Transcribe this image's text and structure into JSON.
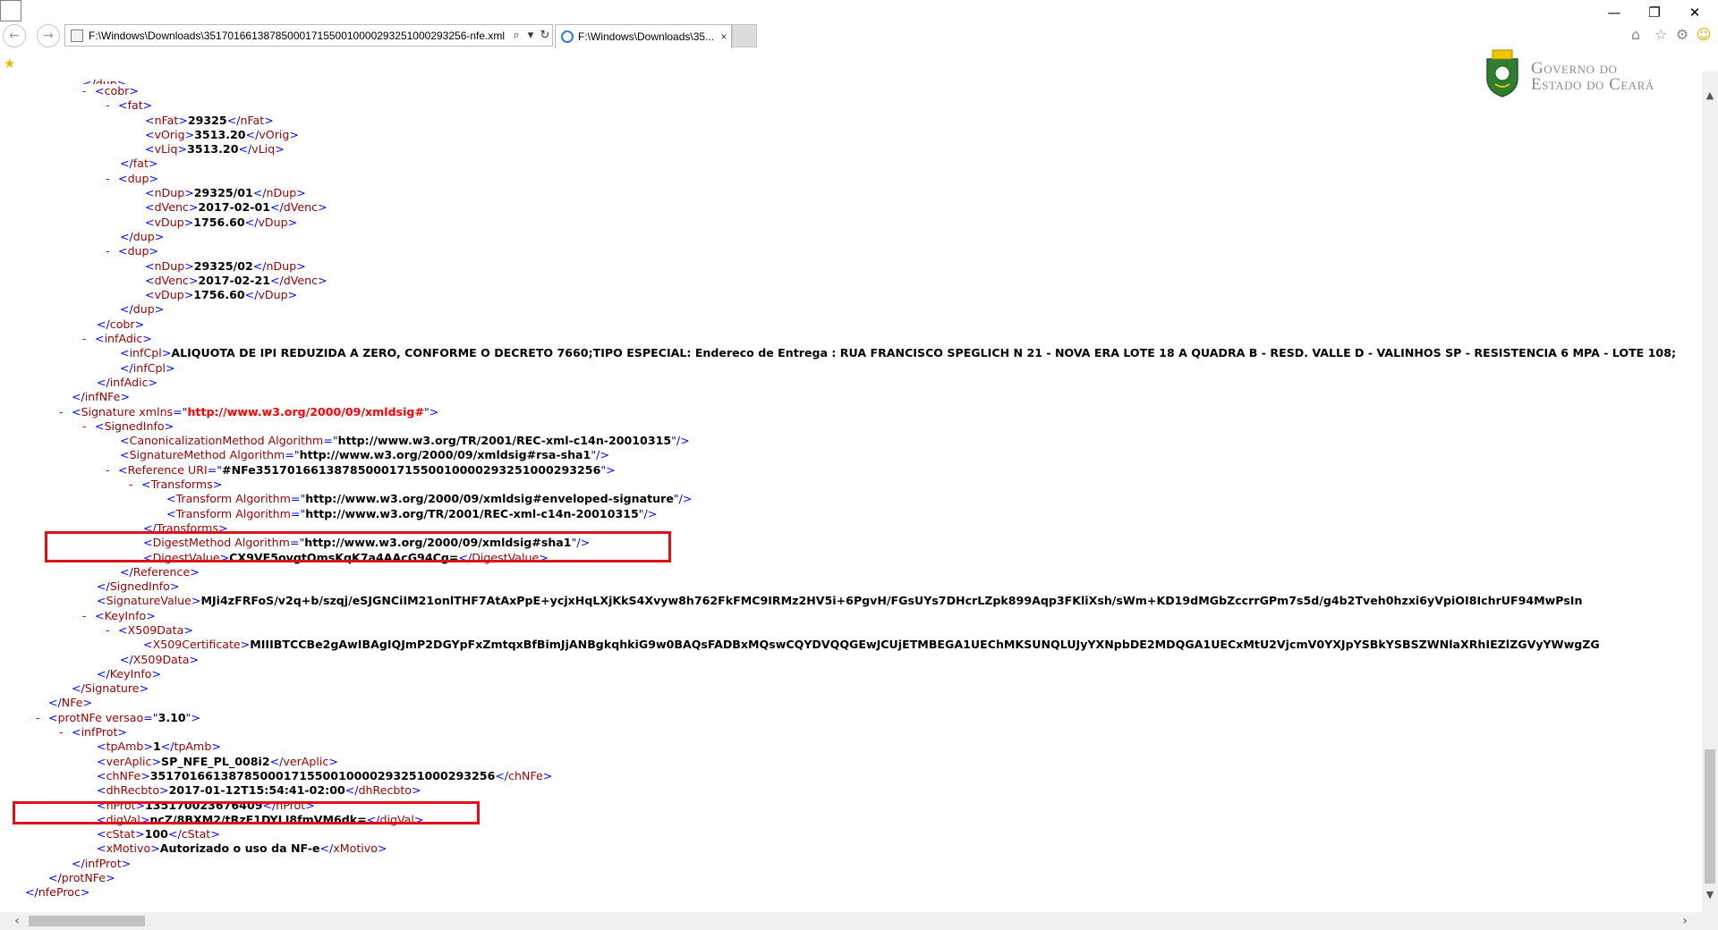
{
  "window": {
    "minimize_glyph": "—",
    "restore_glyph": "❐",
    "close_glyph": "✕"
  },
  "nav": {
    "back_glyph": "←",
    "forward_glyph": "→"
  },
  "address": {
    "url": "F:\\Windows\\Downloads\\35170166138785000171550010000293251000293256-nfe.xml",
    "search_glyph": "⌕",
    "dropdown_glyph": "▾",
    "refresh_glyph": "↻"
  },
  "tab": {
    "label": "F:\\Windows\\Downloads\\35...",
    "close_glyph": "×"
  },
  "toolbar": {
    "home_glyph": "⌂",
    "favorites_glyph": "☆",
    "tools_glyph": "⚙",
    "feedback_glyph": "☺"
  },
  "favorites_bar": {
    "star_glyph": "★"
  },
  "logo": {
    "line1": "Governo do",
    "line2": "Estado do Ceará"
  },
  "scrollbars": {
    "up": "▲",
    "down": "▼",
    "left": "‹",
    "right": "›"
  },
  "xml": {
    "duplicatas_close_partial": "</infNFe>",
    "cobr": "cobr",
    "fat": "fat",
    "nFat": "nFat",
    "nFat_val": "29325",
    "vOrig": "vOrig",
    "vOrig_val": "3513.20",
    "vLiq": "vLiq",
    "vLiq_val": "3513.20",
    "dup": "dup",
    "nDup": "nDup",
    "dVenc": "dVenc",
    "vDup": "vDup",
    "dup1_nDup": "29325/01",
    "dup1_dVenc": "2017-02-01",
    "dup1_vDup": "1756.60",
    "dup2_nDup": "29325/02",
    "dup2_dVenc": "2017-02-21",
    "dup2_vDup": "1756.60",
    "infAdic": "infAdic",
    "infCpl": "infCpl",
    "infCpl_val": "ALIQUOTA DE IPI REDUZIDA A ZERO, CONFORME O DECRETO 7660;TIPO ESPECIAL: Endereco de Entrega : RUA FRANCISCO SPEGLICH N 21 - NOVA ERA LOTE 18 A QUADRA B - RESD. VALLE D - VALINHOS SP - RESISTENCIA 6 MPA - LOTE 108;",
    "infNFe": "infNFe",
    "Signature": "Signature",
    "xmlns": "xmlns",
    "xmlns_val": "http://www.w3.org/2000/09/xmldsig#",
    "SignedInfo": "SignedInfo",
    "CanonicalizationMethod": "CanonicalizationMethod",
    "Algorithm": "Algorithm",
    "canon_val": "http://www.w3.org/TR/2001/REC-xml-c14n-20010315",
    "SignatureMethod": "SignatureMethod",
    "sigmethod_val": "http://www.w3.org/2000/09/xmldsig#rsa-sha1",
    "Reference": "Reference",
    "URI": "URI",
    "uri_val": "#NFe35170166138785000171550010000293251000293256",
    "Transforms": "Transforms",
    "Transform": "Transform",
    "transform1_val": "http://www.w3.org/2000/09/xmldsig#enveloped-signature",
    "transform2_val": "http://www.w3.org/TR/2001/REC-xml-c14n-20010315",
    "DigestMethod": "DigestMethod",
    "digestmethod_val": "http://www.w3.org/2000/09/xmldsig#sha1",
    "DigestValue": "DigestValue",
    "digestvalue_val": "CX9VF5ovgtOmsKqK7a4AAcG94Cg=",
    "SignatureValue": "SignatureValue",
    "signaturevalue_val": "MJi4zFRFoS/v2q+b/szqj/eSJGNCiIM21onlTHF7AtAxPpE+ycjxHqLXjKkS4Xvyw8h762FkFMC9IRMz2HV5i+6PgvH/FGsUYs7DHcrLZpk899Aqp3FKliXsh/sWm+KD19dMGbZccrrGPm7s5d/g4b2Tveh0hzxi6yVpiOI8IchrUF94MwPsIn",
    "KeyInfo": "KeyInfo",
    "X509Data": "X509Data",
    "X509Certificate": "X509Certificate",
    "x509_val": "MIIIBTCCBe2gAwIBAgIQJmP2DGYpFxZmtqxBfBimJjANBgkqhkiG9w0BAQsFADBxMQswCQYDVQQGEwJCUjETMBEGA1UEChMKSUNQLUJyYXNpbDE2MDQGA1UECxMtU2VjcmV0YXJpYSBkYSBSZWNlaXRhIEZlZGVyYWwgZG",
    "NFe": "NFe",
    "protNFe": "protNFe",
    "versao": "versao",
    "versao_val": "3.10",
    "infProt": "infProt",
    "tpAmb": "tpAmb",
    "tpAmb_val": "1",
    "verAplic": "verAplic",
    "verAplic_val": "SP_NFE_PL_008i2",
    "chNFe": "chNFe",
    "chNFe_val": "35170166138785000171550010000293251000293256",
    "dhRecbto": "dhRecbto",
    "dhRecbto_val": "2017-01-12T15:54:41-02:00",
    "nProt": "nProt",
    "nProt_val": "135170023676409",
    "digVal": "digVal",
    "digVal_val": "ncZ/8BXM2/tRzE1DYLI8fmVM6dk=",
    "cStat": "cStat",
    "cStat_val": "100",
    "xMotivo": "xMotivo",
    "xMotivo_val": "Autorizado o uso da NF-e",
    "nfeProc": "nfeProc",
    "toggle": "-"
  },
  "colors": {
    "tag": "#990000",
    "angle_bracket": "#0000ff",
    "namespace_value": "#ff0000",
    "highlight": "#e0101a"
  }
}
